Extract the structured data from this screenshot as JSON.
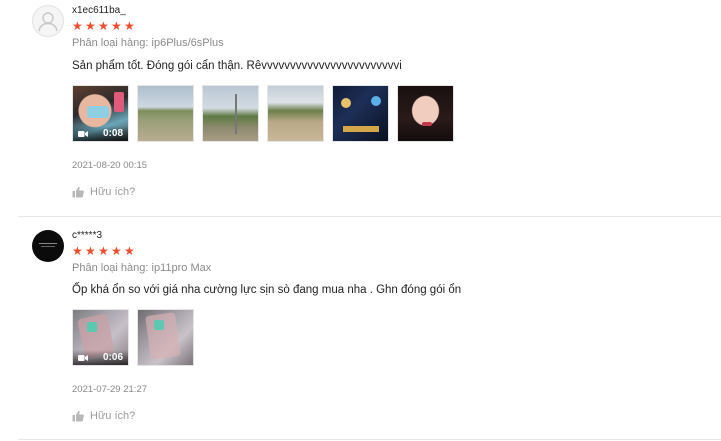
{
  "reviews": [
    {
      "username": "x1ec611ba_",
      "rating": 5,
      "variation": "Phân loại hàng: ip6Plus/6sPlus",
      "comment": "Sản phẩm tốt. Đóng gói cẩn thận. Rêvvvvvvvvvvvvvvvvvvvvvvvvi",
      "video_duration": "0:08",
      "timestamp": "2021-08-20 00:15",
      "helpful": "Hữu ích?"
    },
    {
      "username": "c*****3",
      "rating": 5,
      "variation": "Phân loại hàng: ip11pro Max",
      "comment": "Ốp khá ổn so với giá nha cường lực sịn sò đang mua nha . Ghn đóng gói ổn",
      "video_duration": "0:06",
      "timestamp": "2021-07-29 21:27",
      "helpful": "Hữu ích?"
    }
  ],
  "colors": {
    "star": "#ee4d2d",
    "muted": "#8a8a8a"
  },
  "icons": {
    "avatar_default": "user-silhouette-icon",
    "star": "star-icon",
    "video": "video-camera-icon",
    "helpful": "thumbs-up-icon"
  }
}
